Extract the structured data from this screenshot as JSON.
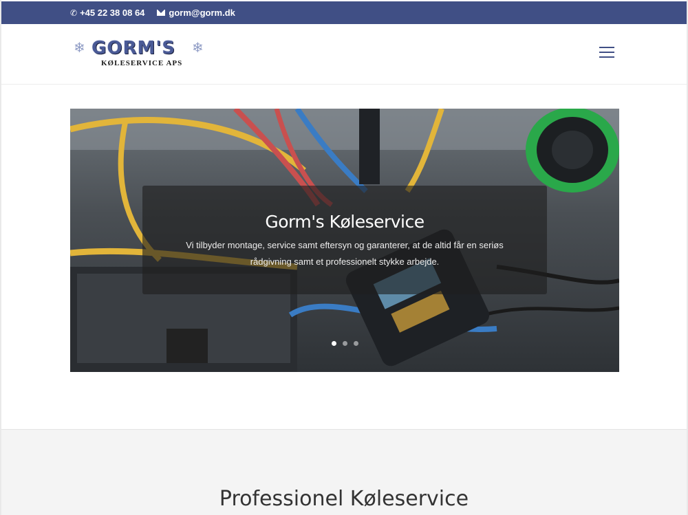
{
  "topbar": {
    "phone": "+45 22 38 08 64",
    "email": "gorm@gorm.dk",
    "bg_color": "#404f85"
  },
  "logo": {
    "brand": "GORM'S",
    "subtitle": "KØLESERVICE APS"
  },
  "hero": {
    "title": "Gorm's Køleservice",
    "description": "Vi tilbyder montage, service samt eftersyn og garanterer, at de altid får en seriøs rådgivning samt et professionelt stykke arbejde.",
    "slide_count": 3,
    "active_slide": 1
  },
  "section": {
    "heading": "Professionel Køleservice"
  },
  "icons": {
    "phone": "phone-icon",
    "email": "mail-icon",
    "menu": "hamburger-menu-icon",
    "logo_decoration": "snowflake-icon"
  }
}
